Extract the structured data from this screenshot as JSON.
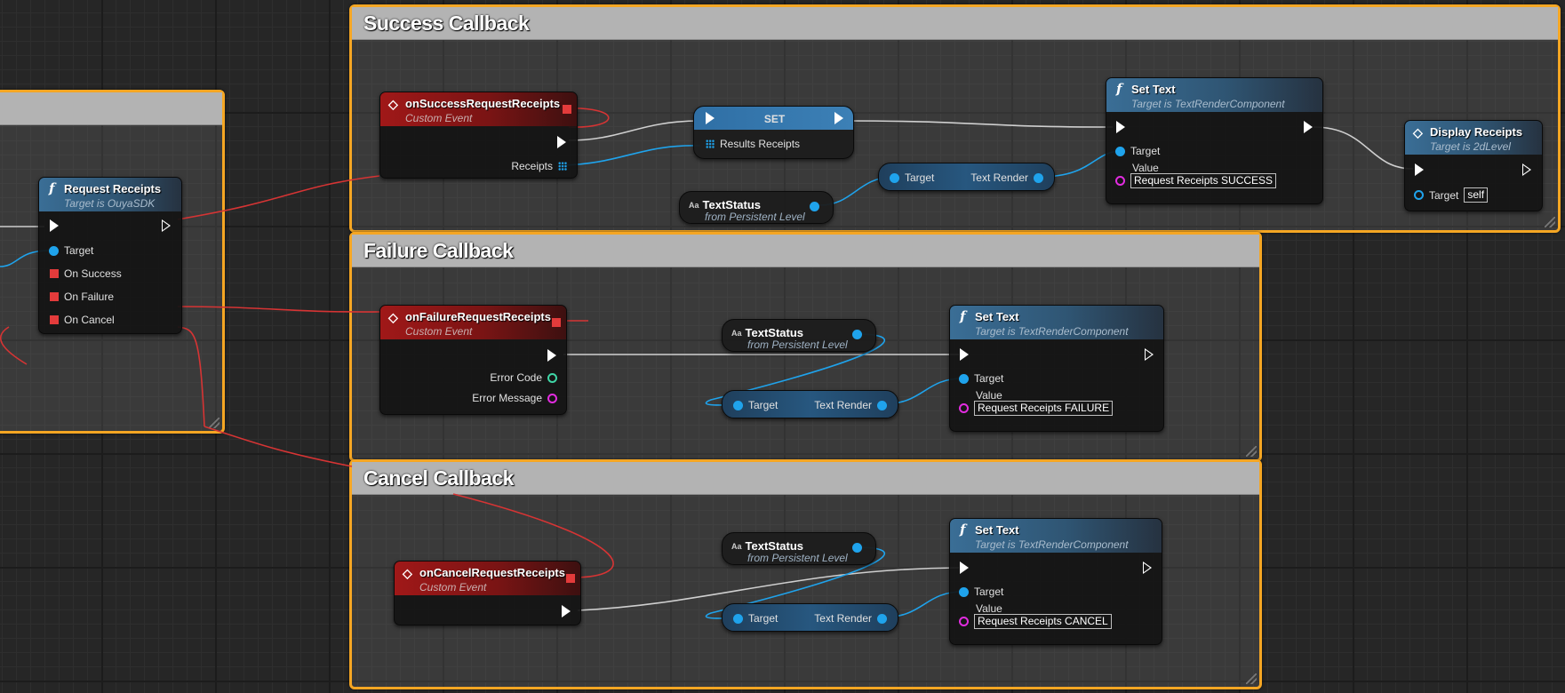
{
  "comments": {
    "success": "Success Callback",
    "failure": "Failure Callback",
    "cancel": "Cancel Callback"
  },
  "request_node": {
    "title": "Request Receipts",
    "subtitle": "Target is OuyaSDK",
    "pins": [
      "Target",
      "On Success",
      "On Failure",
      "On Cancel"
    ]
  },
  "success": {
    "event": {
      "title": "onSuccessRequestReceipts",
      "subtitle": "Custom Event",
      "out_pin": "Receipts"
    },
    "set": {
      "title": "SET",
      "pin": "Results Receipts"
    },
    "var": {
      "title": "TextStatus",
      "subtitle": "from Persistent Level"
    },
    "getter": {
      "left": "Target",
      "right": "Text Render"
    },
    "settext": {
      "title": "Set Text",
      "subtitle": "Target is TextRenderComponent",
      "target": "Target",
      "value_label": "Value",
      "value": "Request Receipts SUCCESS"
    },
    "display": {
      "title": "Display Receipts",
      "subtitle": "Target is 2dLevel",
      "target": "Target",
      "self": "self"
    }
  },
  "failure": {
    "event": {
      "title": "onFailureRequestReceipts",
      "subtitle": "Custom Event",
      "pins": [
        "Error Code",
        "Error Message"
      ]
    },
    "var": {
      "title": "TextStatus",
      "subtitle": "from Persistent Level"
    },
    "getter": {
      "left": "Target",
      "right": "Text Render"
    },
    "settext": {
      "title": "Set Text",
      "subtitle": "Target is TextRenderComponent",
      "target": "Target",
      "value_label": "Value",
      "value": "Request Receipts FAILURE"
    }
  },
  "cancel": {
    "event": {
      "title": "onCancelRequestReceipts",
      "subtitle": "Custom Event"
    },
    "var": {
      "title": "TextStatus",
      "subtitle": "from Persistent Level"
    },
    "getter": {
      "left": "Target",
      "right": "Text Render"
    },
    "settext": {
      "title": "Set Text",
      "subtitle": "Target is TextRenderComponent",
      "target": "Target",
      "value_label": "Value",
      "value": "Request Receipts CANCEL"
    }
  },
  "var_icon": "Aa",
  "colors": {
    "comment_border": "#f5a623",
    "exec": "#ffffff",
    "object_pin": "#1fa3ec",
    "string_pin": "#e22ce0",
    "int_pin": "#3fd6a6",
    "delegate_pin": "#e33b3b"
  }
}
